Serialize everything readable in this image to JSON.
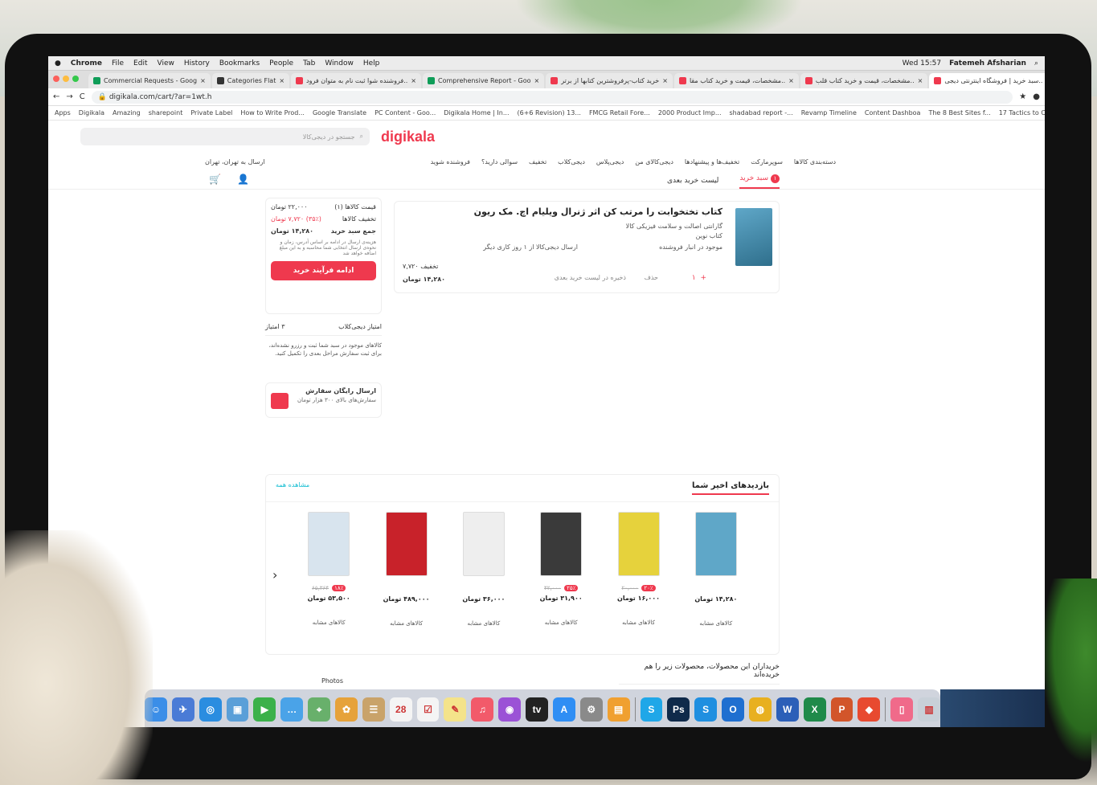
{
  "menubar": {
    "app": "Chrome",
    "items": [
      "File",
      "Edit",
      "View",
      "History",
      "Bookmarks",
      "People",
      "Tab",
      "Window",
      "Help"
    ],
    "clock": "Wed 15:57",
    "user": "Fatemeh Afsharian"
  },
  "tabs": [
    {
      "label": "Commercial Requests - Goog",
      "color": "#0f9d58"
    },
    {
      "label": "Categories Flat",
      "color": "#333333"
    },
    {
      "label": "فروشنده شوا ثبت نام به متوان فرود..",
      "color": "#ef394e"
    },
    {
      "label": "Comprehensive Report - Goo",
      "color": "#0f9d58"
    },
    {
      "label": "خرید کتاب-پرفروشترین کتابها از برتر",
      "color": "#ef394e"
    },
    {
      "label": "مشخصات، قیمت و خرید کتاب مقا..",
      "color": "#ef394e"
    },
    {
      "label": "مشخصات، قیمت و خرید کتاب قلب..",
      "color": "#ef394e"
    },
    {
      "label": "سبد خرید | فروشگاه اینترنتی دیجی..",
      "color": "#ef394e",
      "active": true
    },
    {
      "label": "مشخصات، قیمت و خرید کتاب مقا..",
      "color": "#ef394e"
    }
  ],
  "address": {
    "url": "digikala.com/cart/?ar=1wt.h"
  },
  "bookmarks": [
    "Apps",
    "Digikala",
    "Amazing",
    "sharepoint",
    "Private Label",
    "How to Write Prod...",
    "Google Translate",
    "PC Content - Goo...",
    "Digikala Home | In...",
    "(6+6 Revision) 13...",
    "FMCG Retail Fore...",
    "2000 Product Imp...",
    "shadabad report -...",
    "Revamp Timeline",
    "Content Dashboa",
    "The 8 Best Sites f...",
    "17 Tactics to Creat...",
    "SEO Copywriting"
  ],
  "header": {
    "logo": "digikala",
    "search_placeholder": "جستجو در دیجی‌کالا",
    "ship_to": "ارسال به تهران، تهران"
  },
  "nav": [
    "دسته‌بندی کالاها",
    "سوپرمارکت",
    "تخفیف‌ها و پیشنهادها",
    "دیجی‌کالای من",
    "دیجی‌پلاس",
    "دیجی‌کلاب",
    "تخفیف",
    "سوالی دارید؟",
    "فروشنده شوید"
  ],
  "cart_tabs": {
    "cart": "سبد خرید",
    "cart_count": "۱",
    "later": "لیست خرید بعدی"
  },
  "product": {
    "title": "کتاب تختخوابت را مرتب کن اثر ژنرال ویلیام اچ. مک ریون",
    "attrs": [
      "گارانتی اصالت و سلامت فیزیکی کالا",
      "کتاب نوین",
      "موجود در انبار فروشنده",
      "ارسال دیجی‌کالا از ۱ روز کاری دیگر"
    ],
    "discount_label": "تخفیف ۷,۷۲۰",
    "price": "۱۴,۲۸۰ تومان",
    "qty": "۱",
    "delete": "حذف",
    "save_later": "ذخیره در لیست خرید بعدی"
  },
  "summary": {
    "items_price_label": "قیمت کالاها (۱)",
    "items_price": "۲۲,۰۰۰ تومان",
    "discount_label": "تخفیف کالاها",
    "discount": "(۳۵٪) ۷,۷۲۰ تومان",
    "total_label": "جمع سبد خرید",
    "total": "۱۴,۲۸۰ تومان",
    "note": "هزینه‌ی ارسال در ادامه بر اساس آدرس، زمان و نحوه‌ی ارسال انتخابی شما محاسبه و به این مبلغ اضافه خواهد شد",
    "cta": "ادامه فرآیند خرید"
  },
  "points": {
    "label": "امتیاز دیجی‌کلاب",
    "value": "۳ امتیاز",
    "info": "کالاهای موجود در سبد شما ثبت و رزرو نشده‌اند، برای ثبت سفارش مراحل بعدی را تکمیل کنید."
  },
  "freeship": {
    "title": "ارسال رایگان سفارش",
    "sub": "سفارش‌های بالای ۳۰۰ هزار تومان"
  },
  "recent": {
    "title": "بازدیدهای اخیر شما",
    "see_all": "مشاهده همه",
    "products": [
      {
        "price": "۱۴,۲۸۰ تومان",
        "disc": "",
        "old": "",
        "color": "#5fa7c8",
        "sim": "کالاهای مشابه"
      },
      {
        "price": "۱۶,۰۰۰ تومان",
        "disc": "۲۰٪",
        "old": "۲۰,۰۰۰",
        "color": "#e6d23c",
        "sim": "کالاهای مشابه"
      },
      {
        "price": "۳۱,۹۰۰ تومان",
        "disc": "۲۵٪",
        "old": "۴۲,۰۰۰",
        "color": "#3a3a3a",
        "sim": "کالاهای مشابه"
      },
      {
        "price": "۳۶,۰۰۰ تومان",
        "disc": "",
        "old": "",
        "color": "#eeeeee",
        "sim": "کالاهای مشابه"
      },
      {
        "price": "۴۸۹,۰۰۰ تومان",
        "disc": "",
        "old": "",
        "color": "#c8222a",
        "sim": "کالاهای مشابه"
      },
      {
        "price": "۵۳,۵۰۰ تومان",
        "disc": "۱۸٪",
        "old": "۶۵,۳۶۴",
        "color": "#d8e4ee",
        "sim": "کالاهای مشابه"
      }
    ]
  },
  "also_bought": "خریداران این محصولات، محصولات زیر را هم خریده‌اند",
  "photos_label": "Photos",
  "dock": [
    {
      "name": "finder-icon",
      "color": "#3b8ee8",
      "glyph": "☺"
    },
    {
      "name": "launchpad-icon",
      "color": "#4a7bd6",
      "glyph": "✈"
    },
    {
      "name": "safari-icon",
      "color": "#2a8de0",
      "glyph": "◎"
    },
    {
      "name": "preview-icon",
      "color": "#5a9fd8",
      "glyph": "▣"
    },
    {
      "name": "facetime-icon",
      "color": "#3bb14a",
      "glyph": "▶"
    },
    {
      "name": "messages-icon",
      "color": "#4aa3e8",
      "glyph": "…"
    },
    {
      "name": "maps-icon",
      "color": "#68b06b",
      "glyph": "⌖"
    },
    {
      "name": "photos-icon",
      "color": "#e6a23a",
      "glyph": "✿"
    },
    {
      "name": "contacts-icon",
      "color": "#c9a36a",
      "glyph": "☰"
    },
    {
      "name": "calendar-icon",
      "color": "#f4f4f4",
      "glyph": "28"
    },
    {
      "name": "reminders-icon",
      "color": "#f4f4f4",
      "glyph": "☑"
    },
    {
      "name": "notes-icon",
      "color": "#f4e38a",
      "glyph": "✎"
    },
    {
      "name": "music-icon",
      "color": "#f25a6a",
      "glyph": "♫"
    },
    {
      "name": "podcasts-icon",
      "color": "#9b52d6",
      "glyph": "◉"
    },
    {
      "name": "tv-icon",
      "color": "#222222",
      "glyph": "tv"
    },
    {
      "name": "appstore-icon",
      "color": "#2f8ef4",
      "glyph": "A"
    },
    {
      "name": "settings-icon",
      "color": "#8a8a8a",
      "glyph": "⚙"
    },
    {
      "name": "books-icon",
      "color": "#f0a030",
      "glyph": "▤"
    },
    {
      "name": "skype-icon",
      "color": "#1fa7e8",
      "glyph": "S"
    },
    {
      "name": "photoshop-icon",
      "color": "#0f2a4a",
      "glyph": "Ps"
    },
    {
      "name": "skype-business-icon",
      "color": "#1f8fe0",
      "glyph": "S"
    },
    {
      "name": "outlook-icon",
      "color": "#1f6fd0",
      "glyph": "O"
    },
    {
      "name": "chrome-icon",
      "color": "#e8b020",
      "glyph": "◍"
    },
    {
      "name": "word-icon",
      "color": "#2b5fb8",
      "glyph": "W"
    },
    {
      "name": "excel-icon",
      "color": "#1f8a4a",
      "glyph": "X"
    },
    {
      "name": "powerpoint-icon",
      "color": "#d2552a",
      "glyph": "P"
    },
    {
      "name": "anydesk-icon",
      "color": "#e84a30",
      "glyph": "◆"
    },
    {
      "name": "document-icon",
      "color": "#f06a8a",
      "glyph": "▯"
    },
    {
      "name": "trash-icon",
      "color": "#c8d0d8",
      "glyph": "▥"
    }
  ]
}
